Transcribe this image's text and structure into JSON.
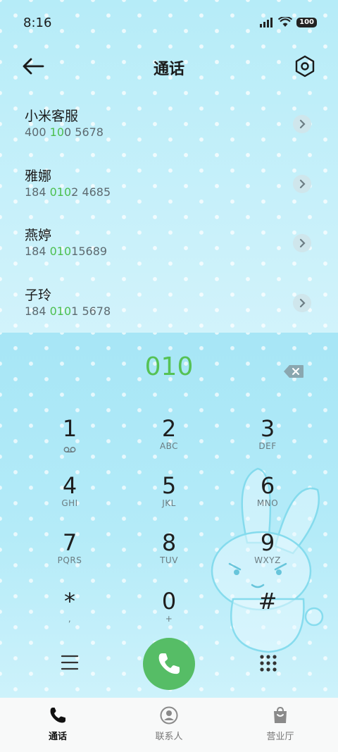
{
  "status": {
    "time": "8:16",
    "battery": "100"
  },
  "header": {
    "title": "通话"
  },
  "contacts": [
    {
      "name": "小米客服",
      "num_parts": [
        "400",
        " 10",
        "0 5678"
      ]
    },
    {
      "name": "雅娜",
      "num_parts": [
        "184 ",
        "010",
        "2 4685"
      ]
    },
    {
      "name": "燕婷",
      "num_parts": [
        "184 ",
        "010",
        "15689"
      ]
    },
    {
      "name": "子玲",
      "num_parts": [
        "184 ",
        "010",
        "1 5678"
      ]
    }
  ],
  "entry": {
    "number": "010"
  },
  "keys": [
    {
      "digit": "1",
      "letters": ""
    },
    {
      "digit": "2",
      "letters": "ABC"
    },
    {
      "digit": "3",
      "letters": "DEF"
    },
    {
      "digit": "4",
      "letters": "GHI"
    },
    {
      "digit": "5",
      "letters": "JKL"
    },
    {
      "digit": "6",
      "letters": "MNO"
    },
    {
      "digit": "7",
      "letters": "PQRS"
    },
    {
      "digit": "8",
      "letters": "TUV"
    },
    {
      "digit": "9",
      "letters": "WXYZ"
    },
    {
      "digit": "*",
      "letters": ","
    },
    {
      "digit": "0",
      "letters": "+"
    },
    {
      "digit": "#",
      "letters": ""
    }
  ],
  "tabs": [
    {
      "label": "通话",
      "icon": "phone-icon"
    },
    {
      "label": "联系人",
      "icon": "person-icon"
    },
    {
      "label": "营业厅",
      "icon": "shopping-bag-icon"
    }
  ],
  "colors": {
    "accent_green": "#4cbf4f",
    "call_button": "#56bd66"
  }
}
